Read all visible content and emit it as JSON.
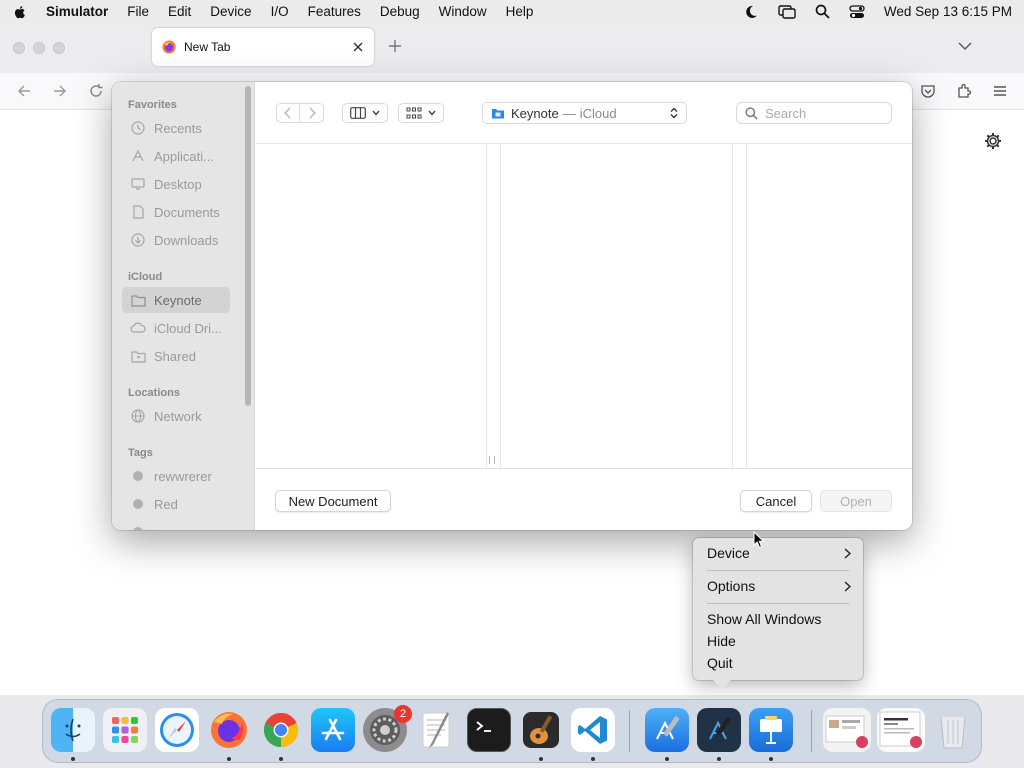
{
  "menubar": {
    "app_name": "Simulator",
    "items": [
      "File",
      "Edit",
      "Device",
      "I/O",
      "Features",
      "Debug",
      "Window",
      "Help"
    ],
    "datetime": "Wed Sep 13  6:15 PM"
  },
  "browser": {
    "tab_title": "New Tab"
  },
  "dialog": {
    "sidebar": {
      "favorites_header": "Favorites",
      "favorites": [
        "Recents",
        "Applicati...",
        "Desktop",
        "Documents",
        "Downloads"
      ],
      "icloud_header": "iCloud",
      "icloud": [
        "Keynote",
        "iCloud Dri...",
        "Shared"
      ],
      "locations_header": "Locations",
      "locations": [
        "Network"
      ],
      "tags_header": "Tags",
      "tags": [
        "rewwrerer",
        "Red"
      ],
      "selected": "Keynote"
    },
    "location": {
      "folder": "Keynote",
      "separator": "—",
      "source": "iCloud"
    },
    "search_placeholder": "Search",
    "buttons": {
      "new_document": "New Document",
      "cancel": "Cancel",
      "open": "Open"
    }
  },
  "context_menu": {
    "items": [
      "Device",
      "Options",
      "Show All Windows",
      "Hide",
      "Quit"
    ]
  },
  "dock": {
    "settings_badge": "2"
  },
  "colors": {
    "accent": "#1e7cf2",
    "badge": "#e8372f",
    "sidebar_bg": "#e6e5e6"
  }
}
